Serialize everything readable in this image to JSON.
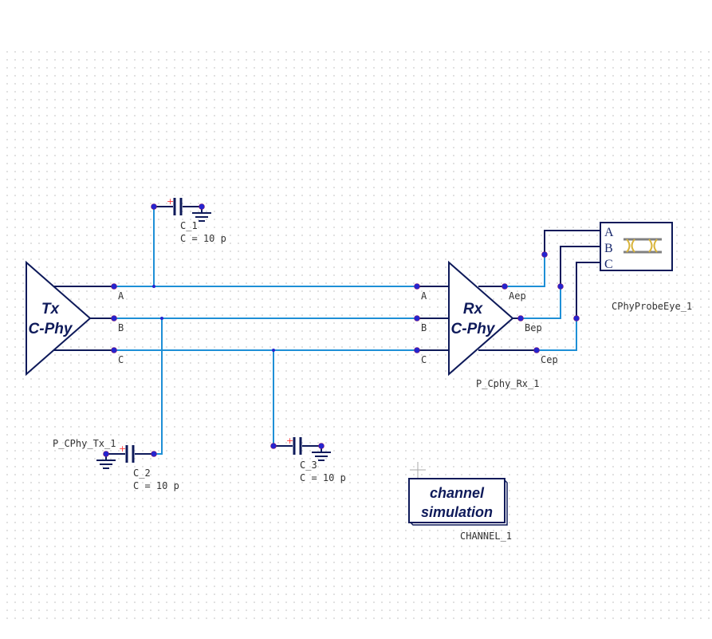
{
  "canvas": {
    "grid": "dotted"
  },
  "colors": {
    "component": "#0e1a5a",
    "wire": "#1e8fd6",
    "node": "#2424d0",
    "plus_marker": "#ff3b3b",
    "eye_glyph": "#d9b43a",
    "eye_bar": "#808080"
  },
  "components": {
    "tx": {
      "line1": "Tx",
      "line2": "C-Phy",
      "instance": "P_CPhy_Tx_1",
      "pins": [
        "A",
        "B",
        "C"
      ]
    },
    "rx": {
      "line1": "Rx",
      "line2": "C-Phy",
      "instance": "P_Cphy_Rx_1",
      "in_pins": [
        "A",
        "B",
        "C"
      ],
      "out_pins": [
        "Aep",
        "Bep",
        "Cep"
      ]
    },
    "c1": {
      "name": "C_1",
      "value": "C = 10 p",
      "polarity": "+"
    },
    "c2": {
      "name": "C_2",
      "value": "C = 10 p",
      "polarity": "+"
    },
    "c3": {
      "name": "C_3",
      "value": "C = 10 p",
      "polarity": "+"
    },
    "probe": {
      "instance": "CPhyProbeEye_1",
      "pins": [
        "A",
        "B",
        "C"
      ],
      "icon": "eye-diagram-icon"
    },
    "channel": {
      "line1": "channel",
      "line2": "simulation",
      "instance": "CHANNEL_1"
    }
  }
}
